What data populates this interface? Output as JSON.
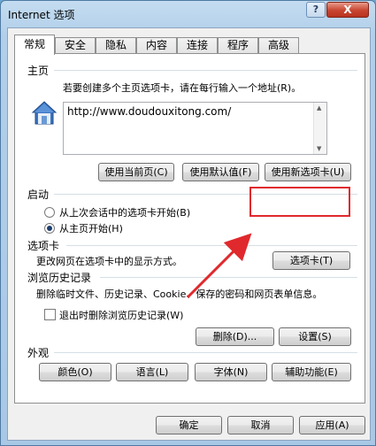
{
  "window": {
    "title": "Internet 选项",
    "help_label": "?",
    "close_label": "X"
  },
  "tabs": [
    {
      "label": "常规"
    },
    {
      "label": "安全"
    },
    {
      "label": "隐私"
    },
    {
      "label": "内容"
    },
    {
      "label": "连接"
    },
    {
      "label": "程序"
    },
    {
      "label": "高级"
    }
  ],
  "home": {
    "title": "主页",
    "description": "若要创建多个主页选项卡，请在每行输入一个地址(R)。",
    "url": "http://www.doudouxitong.com/",
    "buttons": {
      "current": "使用当前页(C)",
      "default": "使用默认值(F)",
      "newtab": "使用新选项卡(U)"
    }
  },
  "startup": {
    "title": "启动",
    "options": [
      {
        "label": "从上次会话中的选项卡开始(B)",
        "checked": false
      },
      {
        "label": "从主页开始(H)",
        "checked": true
      }
    ]
  },
  "tabsection": {
    "title": "选项卡",
    "description": "更改网页在选项卡中的显示方式。",
    "button": "选项卡(T)"
  },
  "history": {
    "title": "浏览历史记录",
    "description": "删除临时文件、历史记录、Cookie、保存的密码和网页表单信息。",
    "checkbox_label": "退出时删除浏览历史记录(W)",
    "checkbox_checked": false,
    "delete_button": "删除(D)...",
    "settings_button": "设置(S)"
  },
  "appearance": {
    "title": "外观",
    "buttons": {
      "colors": "颜色(O)",
      "languages": "语言(L)",
      "fonts": "字体(N)",
      "accessibility": "辅助功能(E)"
    }
  },
  "footer": {
    "ok": "确定",
    "cancel": "取消",
    "apply": "应用(A)"
  },
  "annotation": {
    "highlight_color": "#e0292d"
  }
}
